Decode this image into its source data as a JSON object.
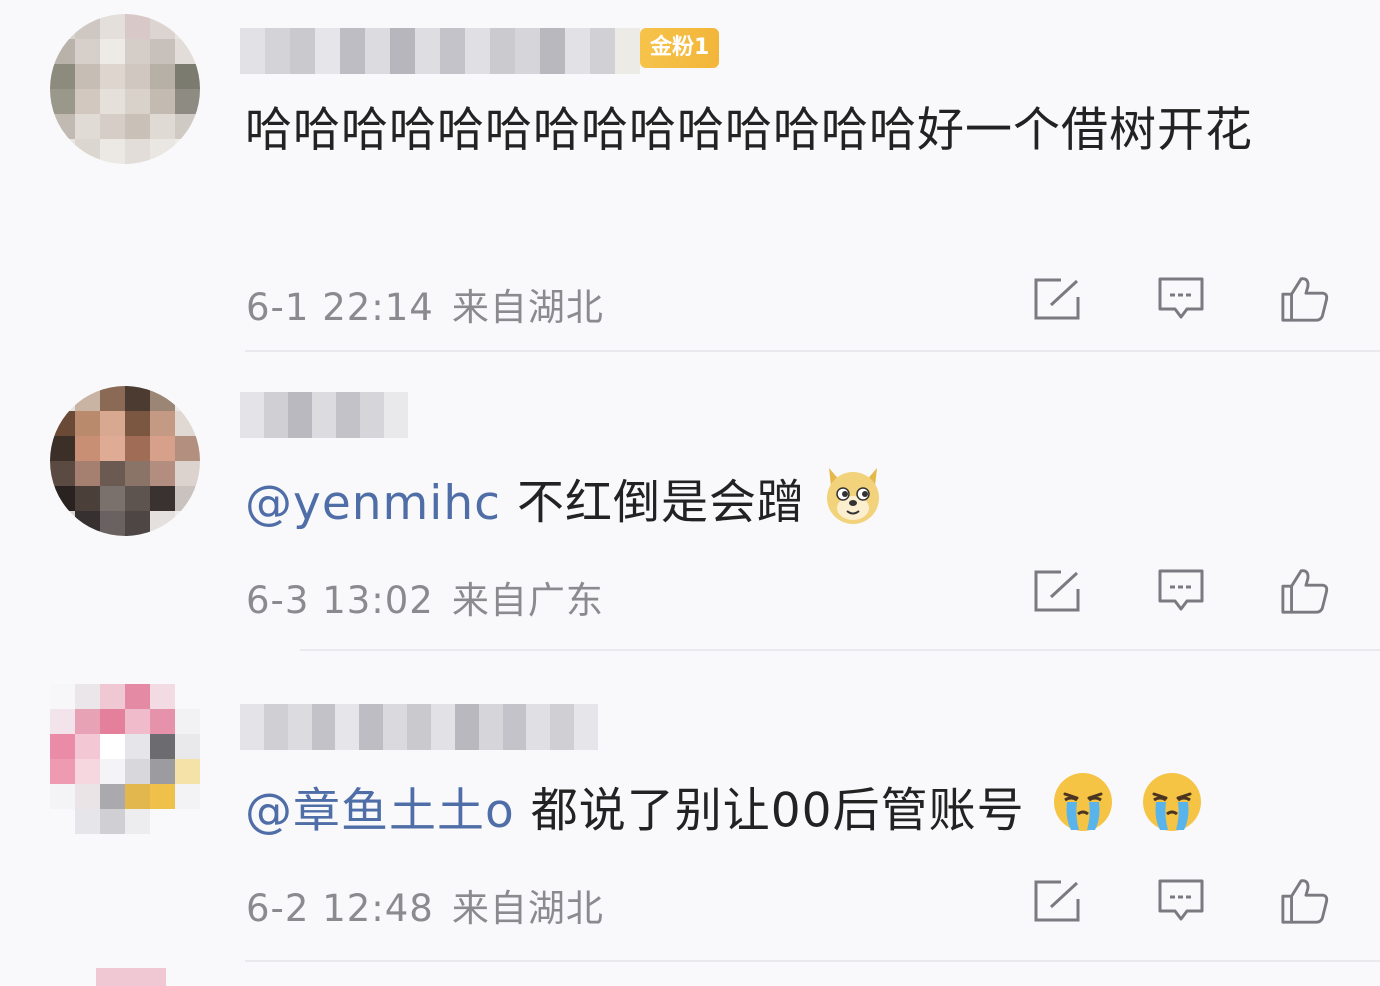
{
  "comments": [
    {
      "badge": "金粉1",
      "text": "哈哈哈哈哈哈哈哈哈哈哈哈哈哈好一个借树开花",
      "mention": "",
      "emojis": [],
      "time": "6-1 22:14",
      "location": "来自湖北"
    },
    {
      "badge": "",
      "mention": "@yenmihc",
      "text": "不红倒是会蹭",
      "emojis": [
        "doge-emoji"
      ],
      "time": "6-3 13:02",
      "location": "来自广东"
    },
    {
      "badge": "",
      "mention": "@章鱼土土o",
      "text": "都说了别让00后管账号",
      "emojis": [
        "crying-emoji",
        "crying-emoji"
      ],
      "time": "6-2 12:48",
      "location": "来自湖北"
    }
  ],
  "icons": {
    "share": "share-icon",
    "comment": "comment-icon",
    "like": "thumbs-up-icon"
  },
  "colors": {
    "mention": "#4f6ea7",
    "meta": "#8a8a8f",
    "badge": "#f2b63a"
  }
}
